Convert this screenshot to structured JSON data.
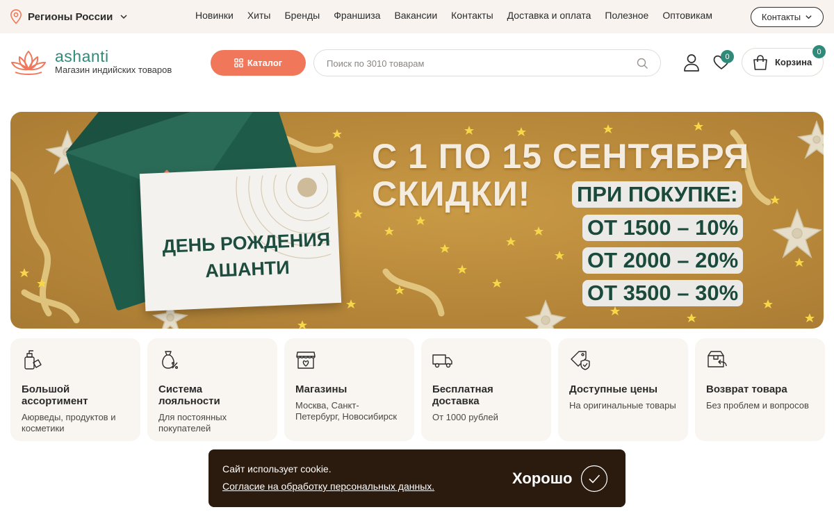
{
  "colors": {
    "accent": "#f1775a",
    "brand_teal": "#2f8a7a",
    "topbar_bg": "#f8f3ee",
    "card_bg": "#f9f5f1",
    "cookie_bg": "#2b1a0e",
    "banner_gold": "#b7873a",
    "banner_green": "#1d4d3e"
  },
  "topbar": {
    "region_icon": "location-pin-icon",
    "region_label": "Регионы России",
    "nav": [
      "Новинки",
      "Хиты",
      "Бренды",
      "Франшиза",
      "Вакансии",
      "Контакты",
      "Доставка и оплата",
      "Полезное",
      "Оптовикам"
    ],
    "contacts_label": "Контакты"
  },
  "header": {
    "logo": {
      "brand": "ashanti",
      "tagline": "Магазин индийских товаров"
    },
    "catalog_label": "Каталог",
    "search_placeholder": "Поиск по 3010 товарам",
    "favorites_count": "0",
    "cart_label": "Корзина",
    "cart_count": "0"
  },
  "banner": {
    "card_line1": "ДЕНЬ РОЖДЕНИЯ",
    "card_line2": "АШАНТИ",
    "headline1": "С 1 ПО 15 СЕНТЯБРЯ",
    "headline2": "СКИДКИ!",
    "subhead": "ПРИ ПОКУПКЕ:",
    "tiers": [
      "ОТ 1500  – 10%",
      "ОТ 2000  – 20%",
      "ОТ 3500  – 30%"
    ]
  },
  "features": [
    {
      "icon": "cosmetics-bottle-icon",
      "title": "Большой ассортимент",
      "desc": "Аюрведы, продуктов и косметики"
    },
    {
      "icon": "discount-bag-icon",
      "title": "Система лояльности",
      "desc": "Для постоянных покупателей"
    },
    {
      "icon": "shop-icon",
      "title": "Магазины",
      "desc": "Москва, Санкт-Петербург, Новосибирск"
    },
    {
      "icon": "delivery-truck-icon",
      "title": "Бесплатная доставка",
      "desc": "От 1000 рублей"
    },
    {
      "icon": "price-tag-icon",
      "title": "Доступные цены",
      "desc": "На оригинальные товары"
    },
    {
      "icon": "return-box-icon",
      "title": "Возврат товара",
      "desc": "Без проблем и вопросов"
    }
  ],
  "cookie": {
    "text": "Сайт использует cookie.",
    "link": "Согласие на обработку персональных данных.",
    "ok_label": "Хорошо"
  }
}
